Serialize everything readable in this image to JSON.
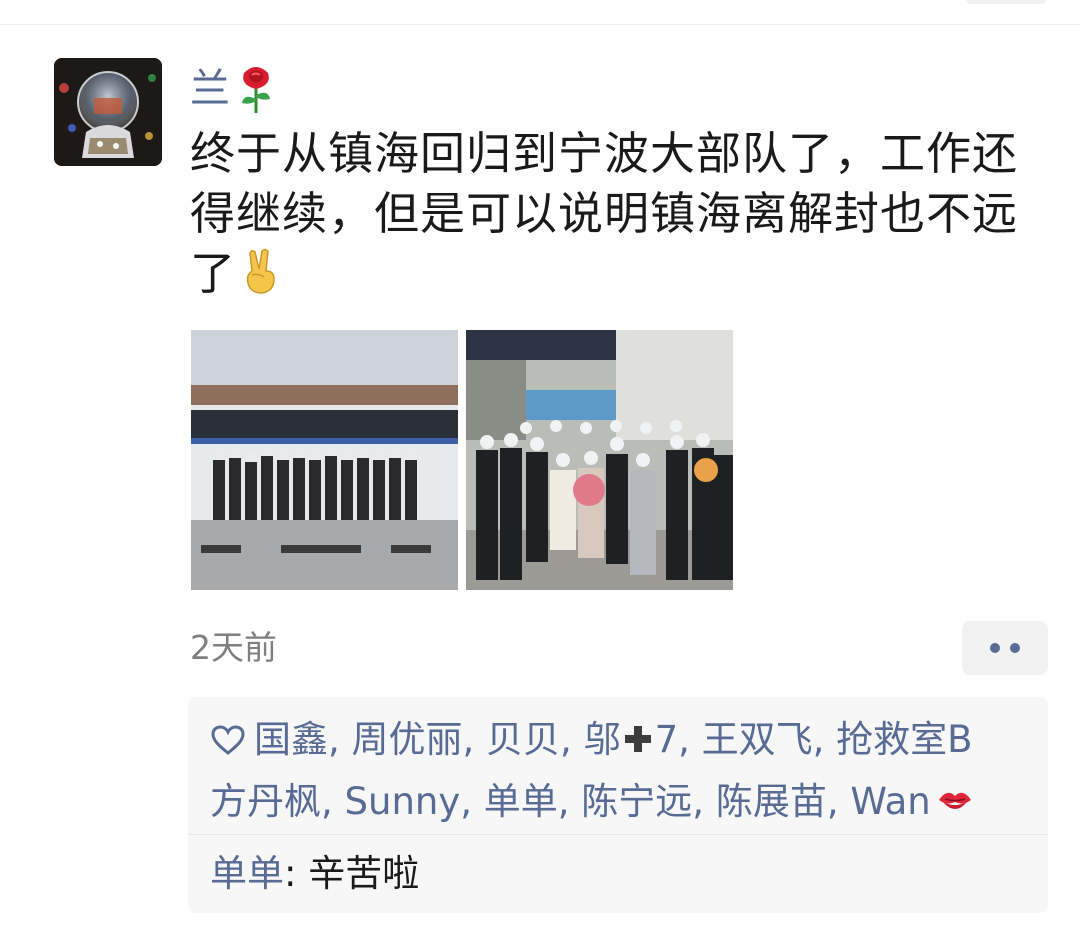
{
  "post": {
    "username": "兰",
    "username_emoji_icon": "rose-icon",
    "text_lines": [
      "终于从镇海回归到宁波大部队了，工作还",
      "得继续，但是可以说明镇海离解封也不远",
      "了"
    ],
    "text_trailing_emoji_icon": "victory-hand-icon",
    "photos": [
      {
        "alt": "group-photo-bus-icon"
      },
      {
        "alt": "group-photo-flowers-icon"
      }
    ],
    "time": "2天前",
    "more_icon": "more-dots-icon"
  },
  "likes": {
    "icon": "heart-outline-icon",
    "line1_a": "国鑫, 周优丽, 贝贝, 邬",
    "line1_b": "7, 王双飞, 抢救室B",
    "line2": "方丹枫, Sunny, 单单, 陈宁远, 陈展苗, Wan",
    "inline_emoji_icons": [
      "heavy-plus-icon",
      "kiss-mark-icon"
    ]
  },
  "comments": [
    {
      "author": "单单",
      "separator": ": ",
      "text": "辛苦啦"
    }
  ],
  "colors": {
    "link": "#576b95",
    "text": "#1a1a1a",
    "meta": "#7f7f7f",
    "panel_bg": "#f7f7f7"
  }
}
